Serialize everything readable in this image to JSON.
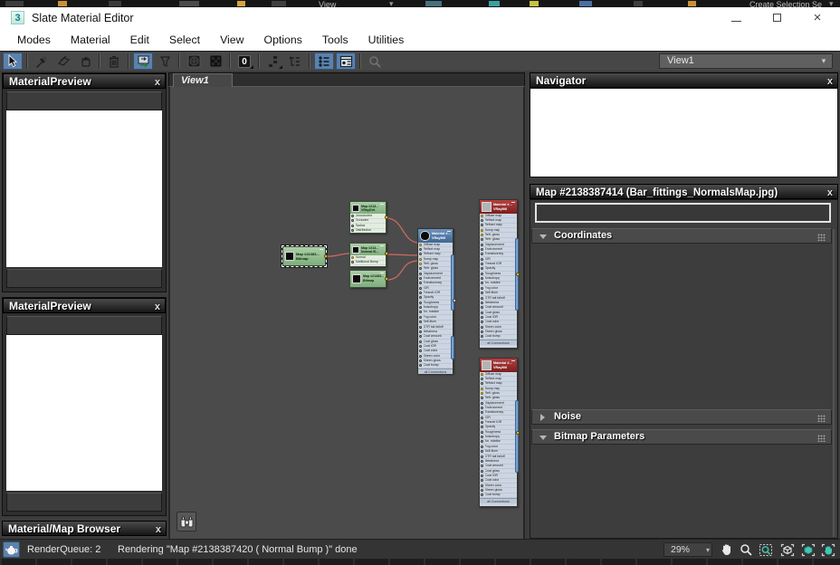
{
  "desktop": {
    "view_label": "View",
    "create_selection_label": "Create Selection Se",
    "caret": "▾"
  },
  "window": {
    "logo_text": "3",
    "title": "Slate Material Editor",
    "close_glyph": "×"
  },
  "menu_items": [
    "Modes",
    "Material",
    "Edit",
    "Select",
    "View",
    "Options",
    "Tools",
    "Utilities"
  ],
  "toolbar": {
    "view_selector": "View1",
    "caret": "▾",
    "zero_label": "0",
    "icons": [
      {
        "name": "select-tool-icon",
        "active": true
      },
      {
        "name": "pick-material-icon",
        "active": false
      },
      {
        "name": "assign-material-icon",
        "active": false
      },
      {
        "name": "put-material-icon",
        "active": false
      },
      {
        "name": "delete-icon",
        "active": false
      },
      {
        "name": "move-children-icon",
        "active": true
      },
      {
        "name": "hide-unused-nodeslots-icon",
        "active": false
      },
      {
        "name": "show-background-icon",
        "active": false
      },
      {
        "name": "show-shaded-material-icon",
        "active": false
      },
      {
        "name": "sample-uv-tiling-icon",
        "active": false
      },
      {
        "name": "layout-all-vertical-icon",
        "active": false
      },
      {
        "name": "layout-children-icon",
        "active": false
      },
      {
        "name": "material-id-channel-icon",
        "active": true
      },
      {
        "name": "parameter-editor-icon",
        "active": true
      },
      {
        "name": "zoom-tool-icon",
        "active": false,
        "disabled": true
      }
    ]
  },
  "panels": {
    "material_preview_1": {
      "title": "MaterialPreview",
      "close": "x"
    },
    "material_preview_2": {
      "title": "MaterialPreview",
      "close": "x"
    },
    "map_browser": {
      "title": "Material/Map Browser",
      "close": "x"
    },
    "navigator": {
      "title": "Navigator",
      "close": "x"
    },
    "map_editor": {
      "title": "Map #2138387414 (Bar_fittings_NormalsMap.jpg)",
      "close": "x",
      "name_field_value": "",
      "rollouts": [
        {
          "label": "Coordinates",
          "state": "expanded"
        },
        {
          "label": "Noise",
          "state": "collapsed"
        },
        {
          "label": "Bitmap Parameters",
          "state": "expanded"
        }
      ]
    }
  },
  "graph": {
    "tab_label": "View1",
    "footer_label": "all Connections",
    "nodes": {
      "bitmap_selected": {
        "title": "Map #21383...",
        "subtitle": "Bitmap"
      },
      "vraydirt": {
        "title": "Map #213...",
        "subtitle": "VRayDirt",
        "slots": [
          "Unoccluded",
          "Occluded",
          "Radius",
          "Distribution"
        ]
      },
      "normal_bump": {
        "title": "Map #213...",
        "subtitle": "Normal B...",
        "slots": [
          "Normal",
          "Additional Bump"
        ]
      },
      "bitmap_2": {
        "title": "Map #21383...",
        "subtitle": "Bitmap"
      },
      "vraymtl_center": {
        "title": "Material #...",
        "subtitle": "VRayMtl"
      },
      "vraymtl_right_1": {
        "title": "Material #...",
        "subtitle": "VRayMtl"
      },
      "vraymtl_right_2": {
        "title": "Material #...",
        "subtitle": "VRayMtl"
      }
    },
    "vraymtl_slots": [
      "Diffuse map",
      "Reflect map",
      "Refract map",
      "Bump map",
      "Refl. gloss",
      "Refr. gloss",
      "Displacement",
      "Environment",
      "Translucency",
      "IOR",
      "Fresnel IOR",
      "Opacity",
      "Roughness",
      "Anisotropy",
      "An. rotation",
      "Fog color",
      "Self-illum",
      "GTR tail falloff",
      "Metalness",
      "Coat amount",
      "Coat gloss",
      "Coat IOR",
      "Coat color",
      "Sheen color",
      "Sheen gloss",
      "Coat bump"
    ],
    "wire_color": "#d06a60"
  },
  "status_bar": {
    "queue_label": "RenderQueue: 2",
    "message": "Rendering \"Map #2138387420  ( Normal Bump )\" done",
    "zoom_level": "29%",
    "caret": "▾",
    "icons": [
      "pan-hand-icon",
      "zoom-icon",
      "zoom-region-icon",
      "zoom-extents-icon",
      "zoom-extents-selected-icon",
      "pan-to-selected-icon"
    ],
    "accent_teal": "#3fc8b4",
    "accent_blue": "#5b81ad"
  }
}
